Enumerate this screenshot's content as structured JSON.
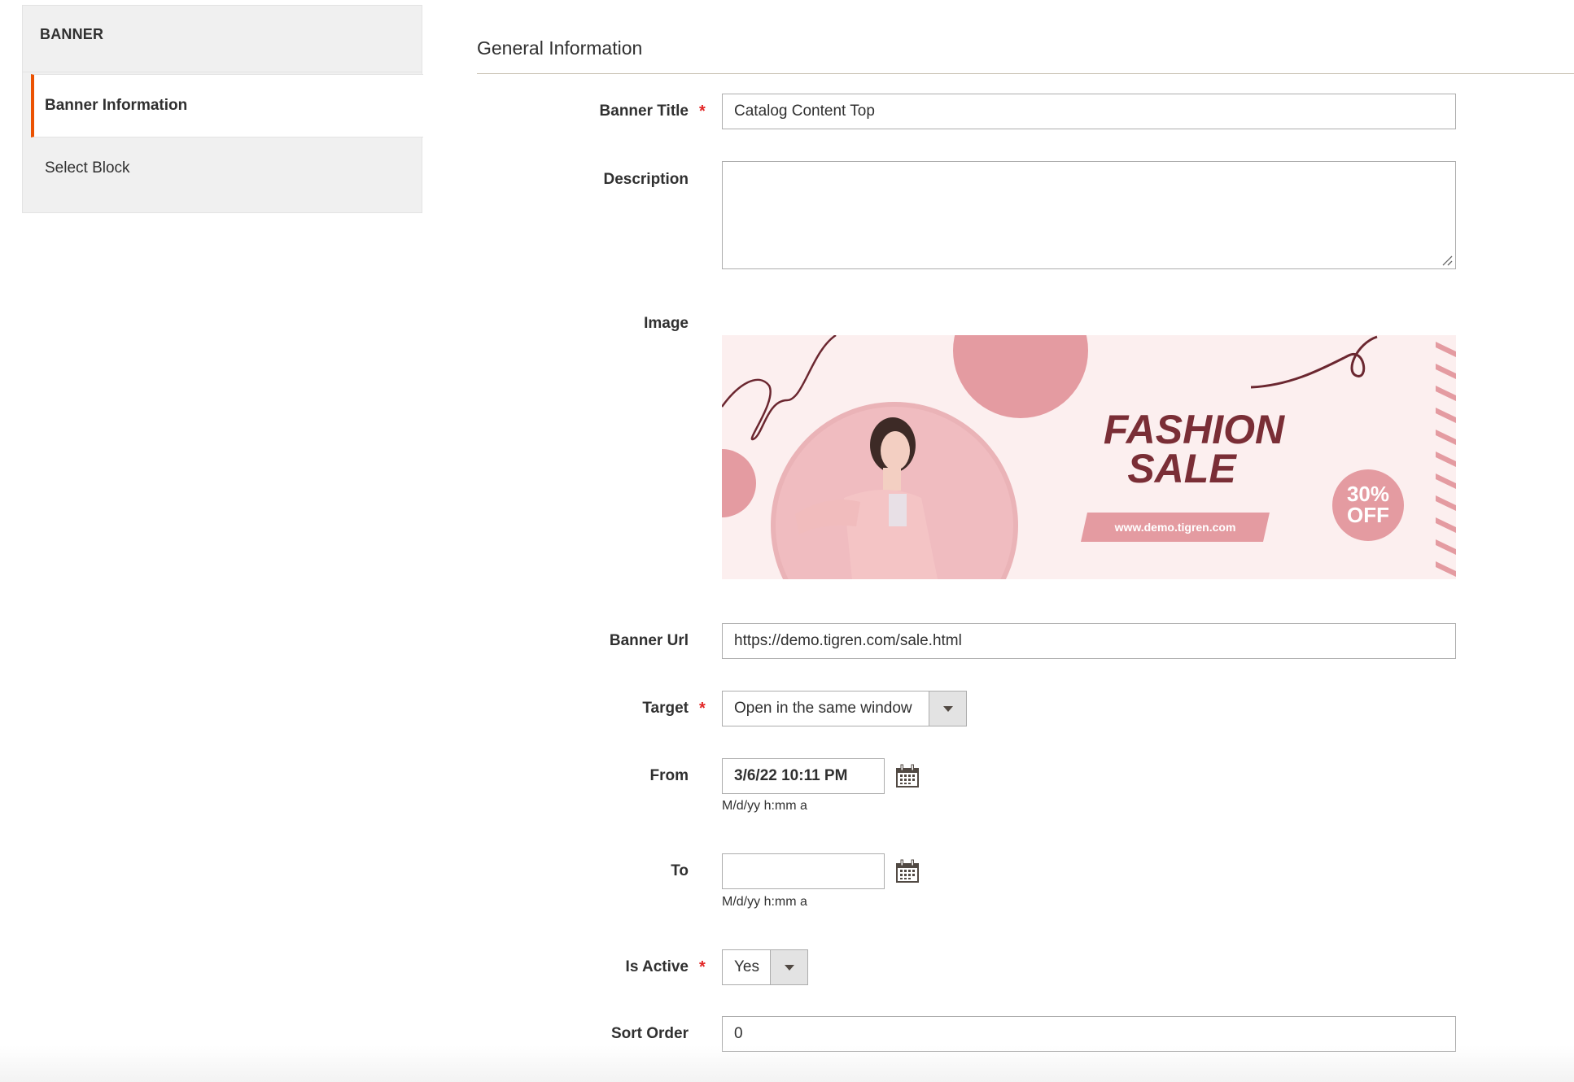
{
  "sidebar": {
    "header": "BANNER",
    "items": [
      {
        "label": "Banner Information",
        "active": true
      },
      {
        "label": "Select Block",
        "active": false
      }
    ]
  },
  "section": {
    "title": "General Information"
  },
  "form": {
    "banner_title": {
      "label": "Banner Title",
      "required": true,
      "value": "Catalog Content Top"
    },
    "description": {
      "label": "Description",
      "value": ""
    },
    "image": {
      "label": "Image",
      "banner": {
        "headline_line1": "FASHION",
        "headline_line2": "SALE",
        "url_text": "www.demo.tigren.com",
        "badge_line1": "30%",
        "badge_line2": "OFF"
      }
    },
    "banner_url": {
      "label": "Banner Url",
      "value": "https://demo.tigren.com/sale.html"
    },
    "target": {
      "label": "Target",
      "required": true,
      "selected": "Open in the same window"
    },
    "from": {
      "label": "From",
      "value": "3/6/22 10:11 PM",
      "format_hint": "M/d/yy h:mm a"
    },
    "to": {
      "label": "To",
      "value": "",
      "format_hint": "M/d/yy h:mm a"
    },
    "is_active": {
      "label": "Is Active",
      "required": true,
      "selected": "Yes"
    },
    "sort_order": {
      "label": "Sort Order",
      "value": "0"
    }
  },
  "icons": {
    "calendar": "calendar-icon",
    "dropdown": "chevron-down-icon",
    "required": "asterisk"
  },
  "colors": {
    "accent": "#eb5202",
    "required": "#e22626",
    "banner_dark": "#7a2e36",
    "banner_pink": "#e49ba1",
    "banner_bg": "#fcefef"
  }
}
